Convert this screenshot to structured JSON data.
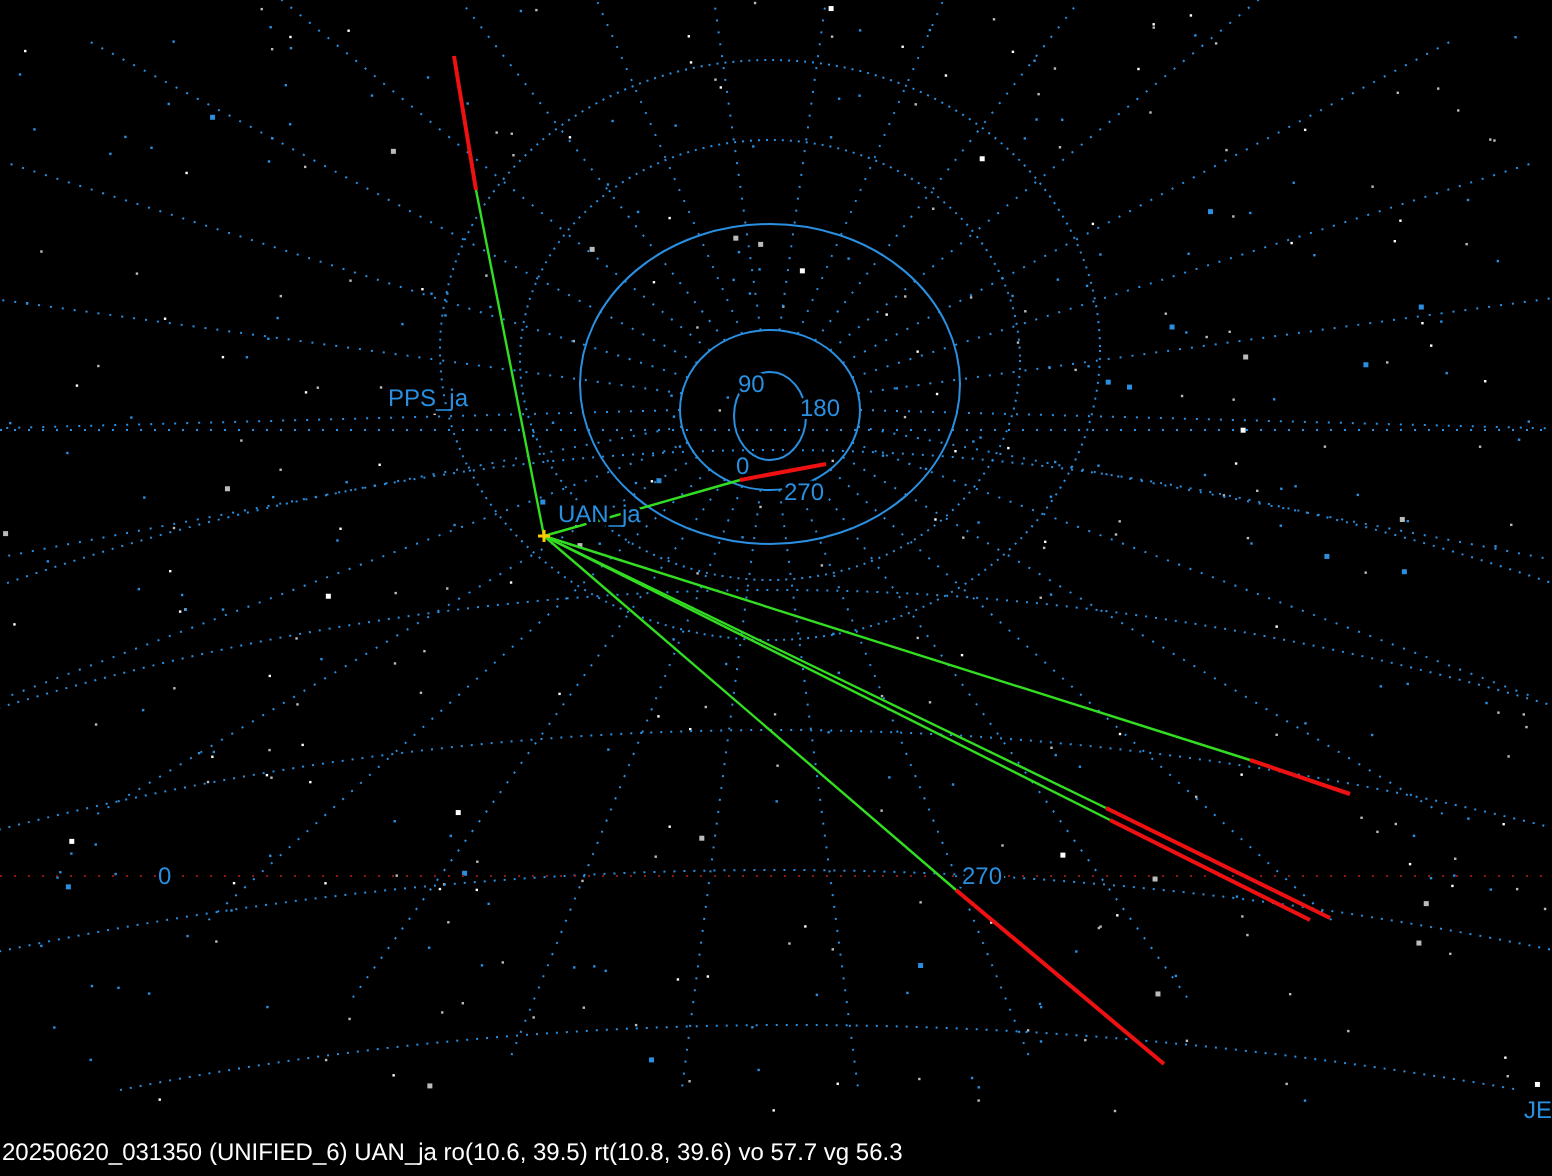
{
  "sites": [
    {
      "label": "PPS_ja"
    },
    {
      "label": "UAN_ja"
    }
  ],
  "polar_labels": [
    "90",
    "180",
    "0",
    "270"
  ],
  "horizon_labels": [
    "0",
    "270"
  ],
  "edge_label": "JE",
  "status_bar": "20250620_031350 (UNIFIED_6) UAN_ja ro(10.6, 39.5) rt(10.8, 39.6) vo 57.7 vg 56.3"
}
